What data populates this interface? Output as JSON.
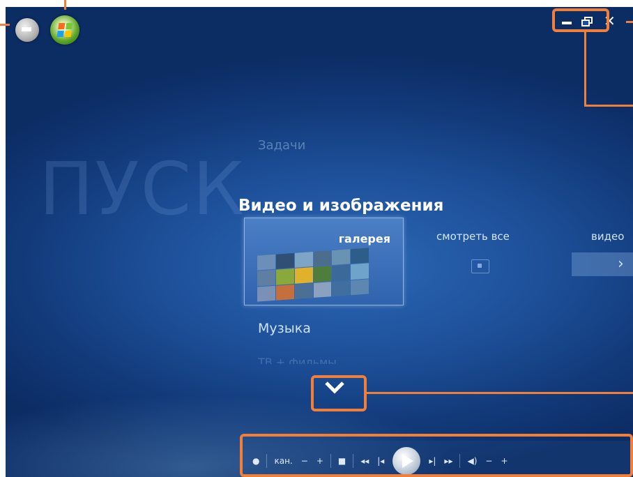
{
  "background_label": "ПУСК",
  "menu": {
    "tasks": "Задачи",
    "video_images": "Видео и изображения",
    "music": "Музыка",
    "tv": "ТВ + фильмы"
  },
  "tiles": {
    "gallery": "галерея",
    "view_all": "смотреть все",
    "video": "видео"
  },
  "transport": {
    "channel_label": "кан.",
    "minus": "−",
    "plus": "+",
    "vol_minus": "−",
    "vol_plus": "+"
  },
  "colors": {
    "background": "#1d4f98",
    "annotation": "#f07f3c"
  },
  "icons": {
    "back": "back-arrow-icon",
    "start": "windows-start-icon",
    "minimize": "minimize-icon",
    "restore": "restore-icon",
    "close": "close-icon",
    "down": "chevron-down-icon",
    "play": "play-icon"
  }
}
